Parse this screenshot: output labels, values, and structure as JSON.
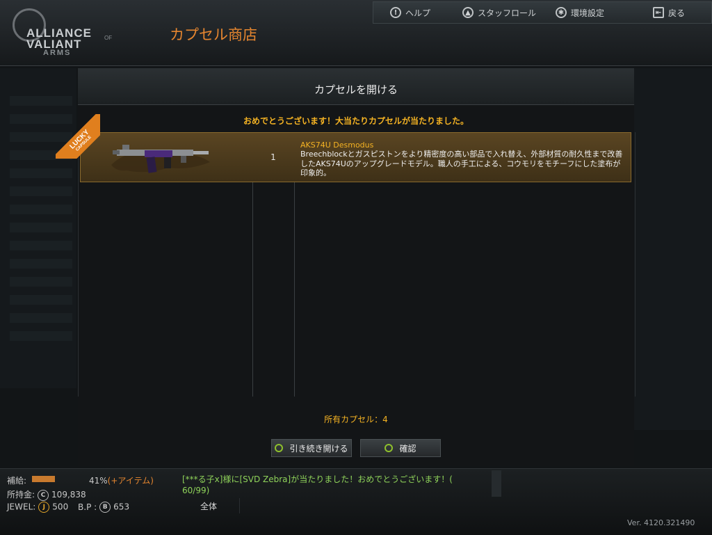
{
  "header": {
    "logo": {
      "line1": "ALLIANCE",
      "line2": "VALIANT",
      "line3": "ARMS",
      "of": "OF"
    },
    "shop_title": "カプセル商店",
    "nav": [
      {
        "label": "ヘルプ",
        "icon": "help-icon"
      },
      {
        "label": "スタッフロール",
        "icon": "staff-icon"
      },
      {
        "label": "環境設定",
        "icon": "gear-icon"
      },
      {
        "label": "戻る",
        "icon": "back-icon"
      }
    ]
  },
  "modal": {
    "title": "カプセルを開ける",
    "congrats": "おめでとうございます！大当たりカプセルが当たりました。",
    "badge": {
      "line1": "LUCKY",
      "line2": "CAPSULE"
    },
    "result": {
      "quantity": "1",
      "item_name": "AKS74U Desmodus",
      "description": " Breechblockとガスピストンをより精密度の高い部品で入れ替え、外部材質の耐久性まで改善したAKS74Uのアップグレードモデル。職人の手工による、コウモリをモチーフにした塗布が印象的。"
    },
    "owned_capsules": "所有カプセル：4",
    "buttons": {
      "continue": "引き続き開ける",
      "confirm": "確認"
    }
  },
  "status": {
    "supply_label": "補給:",
    "supply_value": "41%",
    "supply_item": "(+アイテム)",
    "supply_level": 0.41,
    "money_label": "所持金:",
    "money_value": "109,838",
    "jewel_label": "JEWEL:",
    "jewel_value": "500",
    "bp_label": "B.P :",
    "bp_value": "653",
    "coin_j": "J",
    "coin_b": "B",
    "coin_c": "C"
  },
  "chat": {
    "line1": "[***る子x]様に[SVD Zebra]が当たりました！おめでとうございます！(",
    "line2": "60/99)",
    "tab_all": "全体"
  },
  "version": "Ver. 4120.321490",
  "colors": {
    "accent_orange": "#e6862f",
    "gold_text": "#f5b323",
    "chat_green": "#8fd35a",
    "button_ring": "#8fc02c"
  }
}
